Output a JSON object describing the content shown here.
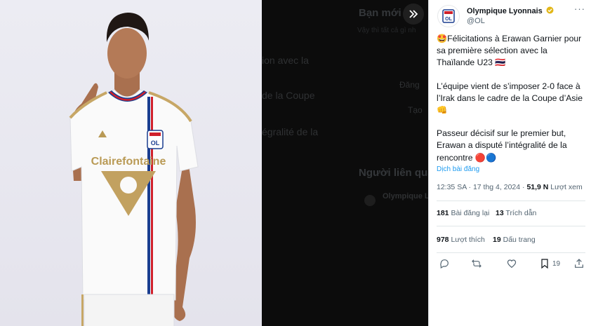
{
  "background_page": {
    "heading": "Bạn mới bi",
    "line1": "Vậy thì tất cả gì nh",
    "line2": "Đăng",
    "line3": "Tạo",
    "people_heading": "Người liên quan",
    "people_name": "Olympique L",
    "left_fragment_1": "ion avec la",
    "left_fragment_2": "de la Coupe",
    "left_fragment_3": "égralité de la"
  },
  "tweet": {
    "author_name": "Olympique Lyonnais",
    "author_handle": "@OL",
    "more_label": "···",
    "paragraphs": [
      "🤩Félicitations à Erawan Garnier pour sa première sélection avec la Thaïlande U23 🇹🇭",
      "L’équipe vient de s’imposer 2-0 face à l’Irak dans le cadre de la Coupe d’Asie 👊",
      "Passeur décisif sur le premier but, Erawan a disputé l’intégralité de la rencontre 🔴🔵"
    ],
    "translate_label": "Dịch bài đăng",
    "timestamp": "12:35 SA · 17 thg 4, 2024 · ",
    "views_count": "51,9 N",
    "views_label": " Lượt xem",
    "reposts_count": "181",
    "reposts_label": " Bài đăng lại",
    "quotes_count": "13",
    "quotes_label": " Trích dẫn",
    "likes_count": "978",
    "likes_label": " Lượt thích",
    "bookmarks_count": "19",
    "bookmarks_label": " Dấu trang",
    "bookmark_action_count": "19"
  },
  "sponsor_text": "Clairefontaine",
  "colors": {
    "link": "#1d9bf0",
    "muted": "#536471",
    "text": "#0f1419",
    "verified": "#e2b719"
  }
}
